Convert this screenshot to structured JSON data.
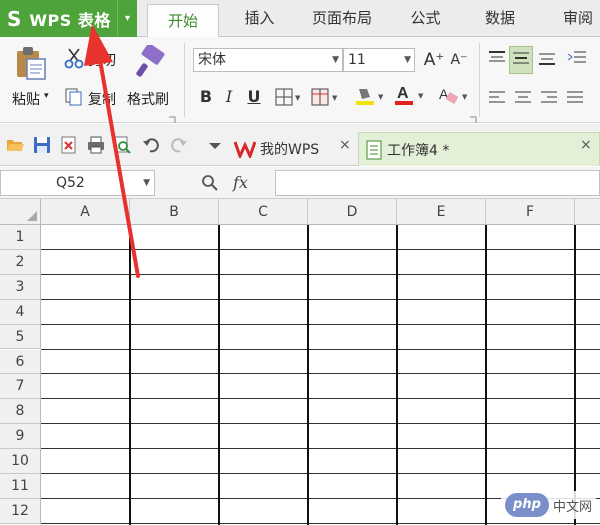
{
  "app": {
    "logo": "S",
    "name": "WPS 表格",
    "menu_arrow": "▾"
  },
  "menu": {
    "tabs": [
      {
        "label": "开始",
        "active": true
      },
      {
        "label": "插入"
      },
      {
        "label": "页面布局"
      },
      {
        "label": "公式"
      },
      {
        "label": "数据"
      },
      {
        "label": "审阅"
      }
    ]
  },
  "ribbon": {
    "paste_label": "粘贴",
    "paste_arrow": "▾",
    "cut_label": "剪切",
    "copy_label": "复制",
    "format_painter_label": "格式刷",
    "font_name": "宋体",
    "font_size": "11",
    "grow_font": "A⁺",
    "shrink_font": "A⁻",
    "bold": "B",
    "italic": "I",
    "underline": "U"
  },
  "quickbar": {
    "doc_tabs": [
      {
        "label": "我的WPS",
        "close": "×"
      },
      {
        "label": "工作簿4 *",
        "close": "×",
        "active": true
      }
    ]
  },
  "formula_bar": {
    "cell_ref": "Q52",
    "fx": "fx",
    "value": ""
  },
  "sheet": {
    "columns": [
      "A",
      "B",
      "C",
      "D",
      "E",
      "F"
    ],
    "rows": [
      "1",
      "2",
      "3",
      "4",
      "5",
      "6",
      "7",
      "8",
      "9",
      "10",
      "11",
      "12"
    ]
  },
  "watermark": {
    "logo": "php",
    "text": "中文网"
  },
  "colors": {
    "app_green": "#4ea43a",
    "active_tab_text": "#3d8c2b",
    "annotation_red": "#e8322e"
  }
}
